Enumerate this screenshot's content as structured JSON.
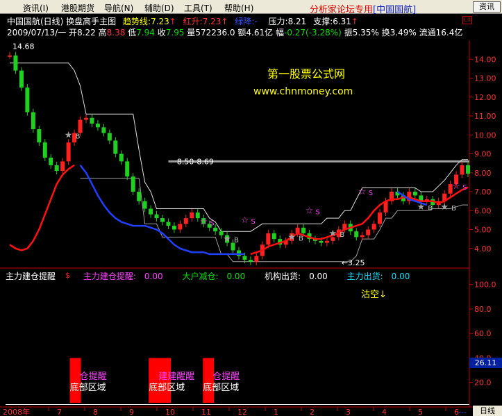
{
  "menu": {
    "items": [
      "资讯(I)",
      "港股期货",
      "导航(N)",
      "辅助(D)",
      "工具(T)",
      "帮助(H)"
    ],
    "brand_prefix": "分析家论坛专用",
    "brand_tag": "[中国国航]",
    "info_button": "资讯"
  },
  "header": {
    "title": "中国国航(日线) 换盘高手主图",
    "trend_label": "趋势线:",
    "trend_value": "7.23",
    "rise_label": "红升:",
    "rise_value": "7.23",
    "fall_label": "绿降:",
    "fall_value": "-",
    "pressure_label": "压力:",
    "pressure_value": "8.21",
    "support_label": "支撑:",
    "support_value": "6.31",
    "date": "2009/07/13/一",
    "open_label": "开",
    "open_value": "8.22",
    "high_label": "高",
    "high_value": "8.38",
    "low_label": "低",
    "low_value": "7.94",
    "close_label": "收",
    "close_value": "7.95",
    "volume_label": "量",
    "volume_value": "572236.0",
    "amount_label": "额",
    "amount_value": "4.61亿",
    "change_label": "幅",
    "change_value": "-0.27(-3.28%)",
    "amplitude_label": "振",
    "amplitude_value": "5.35%",
    "turnover_label": "换",
    "turnover_value": "3.49%",
    "float_label": "流通",
    "float_value": "16.4亿"
  },
  "watermark": {
    "title": "第一股票公式网",
    "url": "www.chnmoney.com"
  },
  "sub_legend": {
    "items": [
      {
        "label": "主力建仓提醒",
        "value": "",
        "color": "#ffffff"
      },
      {
        "label": "主力建仓提醒:",
        "value": "0.00",
        "color": "#ff40ff"
      },
      {
        "label": "大户减仓:",
        "value": "0.00",
        "color": "#00e000"
      },
      {
        "label": "机构出货:",
        "value": "0.00",
        "color": "#ffffff"
      },
      {
        "label": "主力出货:",
        "value": "0.00",
        "color": "#00e0ff"
      }
    ]
  },
  "bottom": {
    "year_label": "2008年",
    "timeframe": "日线",
    "right_badge": "26.11",
    "dash": "---"
  },
  "chart_data": [
    {
      "type": "line",
      "name": "main_price_chart",
      "y_axis_ticks": [
        4.0,
        5.0,
        6.0,
        7.0,
        8.0,
        9.0,
        10.0,
        11.0,
        12.0,
        13.0,
        14.0
      ],
      "ylim": [
        3.0,
        15.0
      ],
      "x_tick_labels": [
        "7",
        "8",
        "9",
        "10",
        "11",
        "12",
        "1",
        "2",
        "3",
        "4",
        "5",
        "6",
        "7"
      ],
      "annotations": [
        {
          "text": "14.68",
          "x_index": 0,
          "y": 14.68
        },
        {
          "text": "8.50-8.69",
          "x_index": 28,
          "y": 8.6
        },
        {
          "text": "3.25",
          "x_index": 56,
          "y": 3.25
        },
        {
          "text": "$",
          "x_index": 9,
          "y": 2.6
        }
      ],
      "resistance_line": 8.6,
      "close_series": [
        14.2,
        13.4,
        12.5,
        11.2,
        10.3,
        9.6,
        8.8,
        8.4,
        8.1,
        8.6,
        9.6,
        10.1,
        10.8,
        10.9,
        10.6,
        10.4,
        10.1,
        9.7,
        9.0,
        8.6,
        7.8,
        7.0,
        6.5,
        6.1,
        5.8,
        5.6,
        5.4,
        5.2,
        5.0,
        5.3,
        5.6,
        5.9,
        5.6,
        5.3,
        5.1,
        4.9,
        4.7,
        4.3,
        3.9,
        3.6,
        3.4,
        3.3,
        3.6,
        4.2,
        4.8,
        4.5,
        4.2,
        4.4,
        4.8,
        5.1,
        4.8,
        4.5,
        4.4,
        4.3,
        4.4,
        4.6,
        5.0,
        5.3,
        4.9,
        4.6,
        4.7,
        5.0,
        5.3,
        5.9,
        6.5,
        7.0,
        6.8,
        6.5,
        7.0,
        6.8,
        6.5,
        6.6,
        6.3,
        6.5,
        6.9,
        7.4,
        7.9,
        8.4,
        7.95
      ],
      "trend_red": [
        4.2,
        4.0,
        3.9,
        4.0,
        4.4,
        5.0,
        5.8,
        6.6,
        7.4,
        7.9,
        8.2,
        8.4,
        null,
        null,
        null,
        null,
        null,
        null,
        null,
        null,
        null,
        null,
        null,
        null,
        null,
        null,
        null,
        null,
        null,
        null,
        null,
        null,
        null,
        null,
        null,
        null,
        null,
        null,
        null,
        null,
        null,
        3.7,
        3.8,
        3.9,
        4.1,
        4.2,
        4.3,
        4.4,
        4.6,
        4.8,
        4.7,
        4.6,
        4.5,
        4.5,
        4.6,
        4.7,
        4.8,
        5.0,
        5.1,
        5.2,
        5.3,
        5.6,
        6.0,
        6.3,
        6.5,
        6.6,
        6.6,
        6.7,
        6.7,
        6.6,
        6.5,
        6.5,
        6.5,
        6.4,
        6.5,
        6.7,
        6.9,
        7.1,
        7.23
      ],
      "trend_blue": [
        null,
        null,
        null,
        null,
        null,
        null,
        null,
        null,
        null,
        null,
        null,
        null,
        8.4,
        8.0,
        7.4,
        6.8,
        6.3,
        5.9,
        5.6,
        5.4,
        5.3,
        5.2,
        5.2,
        5.2,
        5.1,
        5.0,
        4.8,
        4.5,
        4.2,
        4.0,
        3.9,
        3.8,
        3.8,
        3.8,
        3.7,
        3.7,
        3.7,
        3.7,
        3.7,
        3.7,
        3.7,
        null,
        null,
        null,
        null,
        null,
        null,
        null,
        null,
        null,
        null,
        null,
        null,
        null,
        null,
        null,
        null,
        null,
        null,
        null,
        null,
        null,
        null,
        null,
        null,
        null,
        7.0,
        6.8,
        6.6,
        6.5,
        6.4,
        6.3,
        null,
        null,
        null,
        null,
        null,
        null,
        null
      ],
      "upper_white": [
        13.8,
        13.8,
        13.8,
        13.8,
        13.8,
        13.8,
        13.8,
        13.8,
        13.8,
        13.8,
        13.8,
        13.4,
        12.6,
        11.1,
        11.1,
        11.1,
        11.1,
        11.1,
        11.1,
        11.1,
        11.1,
        11.1,
        9.2,
        7.5,
        7.0,
        6.1,
        6.1,
        6.1,
        6.1,
        6.1,
        6.1,
        6.1,
        6.1,
        6.1,
        5.6,
        5.4,
        4.9,
        4.9,
        4.9,
        4.9,
        4.9,
        4.9,
        5.1,
        5.3,
        5.3,
        5.3,
        5.3,
        5.3,
        5.3,
        5.3,
        5.3,
        5.3,
        5.3,
        5.3,
        5.6,
        5.6,
        5.6,
        6.0,
        6.0,
        6.6,
        7.2,
        7.2,
        7.2,
        7.2,
        7.2,
        7.2,
        7.2,
        7.2,
        7.2,
        7.2,
        7.0,
        7.0,
        7.0,
        7.3,
        7.6,
        8.0,
        8.4,
        8.7,
        8.7
      ],
      "lower_white": [
        null,
        null,
        null,
        null,
        null,
        null,
        null,
        null,
        null,
        null,
        null,
        null,
        7.7,
        7.7,
        7.7,
        7.7,
        7.7,
        7.7,
        7.7,
        7.7,
        7.7,
        7.7,
        7.7,
        5.3,
        5.3,
        5.3,
        4.6,
        4.6,
        4.6,
        4.6,
        4.6,
        4.6,
        4.6,
        4.6,
        4.6,
        4.6,
        3.7,
        3.7,
        3.3,
        3.3,
        3.3,
        3.3,
        3.3,
        3.3,
        3.3,
        3.3,
        3.3,
        3.3,
        3.3,
        3.3,
        3.3,
        3.3,
        3.3,
        3.3,
        3.3,
        3.3,
        3.3,
        3.3,
        3.3,
        3.6,
        4.5,
        4.5,
        4.5,
        5.0,
        5.6,
        5.6,
        6.0,
        6.0,
        6.0,
        6.0,
        6.0,
        6.0,
        6.1,
        6.1,
        6.1,
        6.1,
        6.2,
        6.3,
        6.3
      ],
      "buy_markers": [
        {
          "x_index": 10,
          "y": 10.0,
          "label": "B"
        },
        {
          "x_index": 37,
          "y": 4.5,
          "label": "B"
        },
        {
          "x_index": 48,
          "y": 4.6,
          "label": "B"
        },
        {
          "x_index": 55,
          "y": 4.8,
          "label": "B"
        },
        {
          "x_index": 70,
          "y": 6.2,
          "label": "B"
        },
        {
          "x_index": 74,
          "y": 6.2,
          "label": "B"
        }
      ],
      "sell_markers": [
        {
          "x_index": 33,
          "y": 5.4,
          "label": "S"
        },
        {
          "x_index": 40,
          "y": 5.5,
          "label": "S"
        },
        {
          "x_index": 51,
          "y": 6.0,
          "label": "S"
        },
        {
          "x_index": 60,
          "y": 7.0,
          "label": "S"
        },
        {
          "x_index": 76,
          "y": 7.3,
          "label": "S"
        }
      ]
    },
    {
      "type": "bar",
      "name": "sub_indicator",
      "y_axis_ticks": [
        20.0,
        40.0,
        60.0,
        80.0,
        100.0
      ],
      "ylim": [
        0,
        110
      ],
      "annotation": "沽空↓",
      "bars": [
        {
          "x_index": 6,
          "value": 40,
          "width": 2
        },
        {
          "x_index": 22,
          "value": 40,
          "width": 4
        },
        {
          "x_index": 33,
          "value": 40,
          "width": 2
        }
      ],
      "bar_labels": [
        {
          "x_index": 6,
          "top": "仓提醒",
          "bottom": "底部区域"
        },
        {
          "x_index": 22,
          "top": "建建醒醒",
          "bottom": "底部区域"
        },
        {
          "x_index": 33,
          "top": "仓提醒",
          "bottom": "底部区域"
        }
      ],
      "baseline": 2
    }
  ]
}
